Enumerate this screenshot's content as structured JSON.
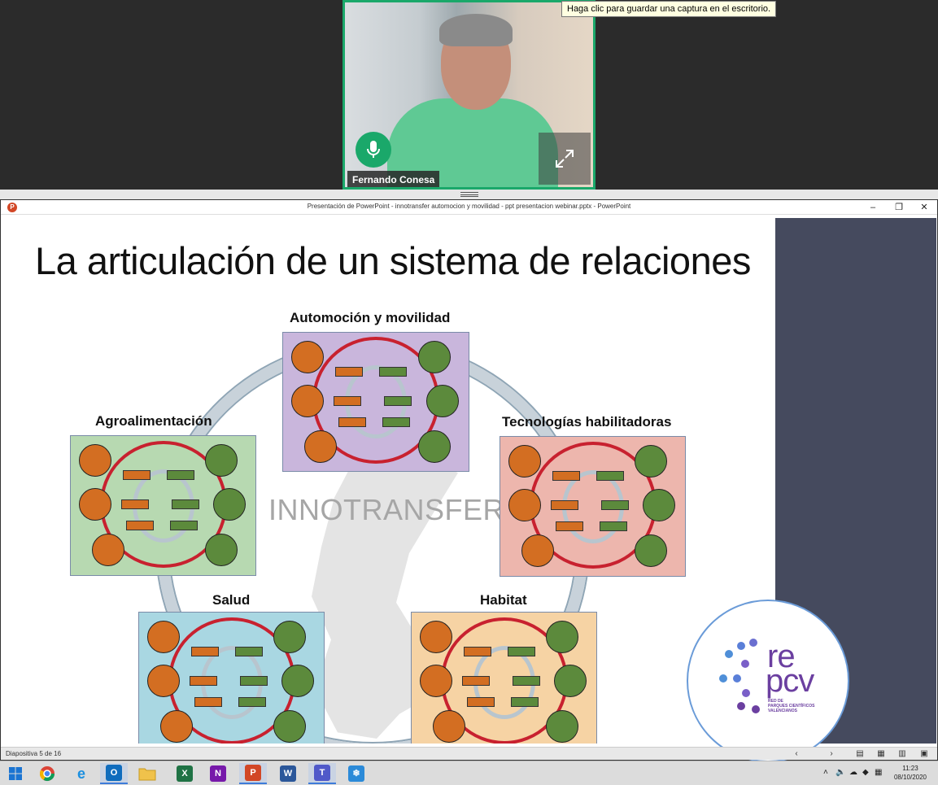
{
  "video": {
    "participant_name": "Fernando Conesa",
    "tooltip": "Haga clic para guardar una captura en el escritorio."
  },
  "ppt": {
    "window_title": "Presentación de PowerPoint  -  innotransfer automocion y movilidad - ppt presentacion webinar.pptx - PowerPoint",
    "status_text": "Diapositiva 5 de 16",
    "slide": {
      "title": "La articulación de un sistema de relaciones",
      "center_label": "INNOTRANSFER",
      "clusters": [
        {
          "label": "Automoción y movilidad",
          "color": "#c9b6dc"
        },
        {
          "label": "Agroalimentación",
          "color": "#b7d9b1"
        },
        {
          "label": "Tecnologías habilitadoras",
          "color": "#edb6ad"
        },
        {
          "label": "Salud",
          "color": "#a9d7e2"
        },
        {
          "label": "Habitat",
          "color": "#f6d3a4"
        }
      ],
      "logo": {
        "line1": "re",
        "line2": "pcv",
        "subtitle_1": "RED DE",
        "subtitle_2": "PARQUES CIENTÍFICOS",
        "subtitle_3": "VALENCIANOS",
        "color": "#6b3fa0"
      }
    }
  },
  "taskbar": {
    "apps": [
      {
        "name": "start",
        "icon": "windows-icon"
      },
      {
        "name": "chrome",
        "icon": "chrome-icon"
      },
      {
        "name": "internet-explorer",
        "icon": "ie-icon"
      },
      {
        "name": "outlook",
        "icon": "outlook-icon",
        "glyph": "O"
      },
      {
        "name": "file-explorer",
        "icon": "folder-icon"
      },
      {
        "name": "excel",
        "icon": "excel-icon",
        "glyph": "X"
      },
      {
        "name": "onenote",
        "icon": "onenote-icon",
        "glyph": "N"
      },
      {
        "name": "powerpoint",
        "icon": "powerpoint-icon",
        "glyph": "P"
      },
      {
        "name": "word",
        "icon": "word-icon",
        "glyph": "W"
      },
      {
        "name": "teams",
        "icon": "teams-icon",
        "glyph": "T"
      },
      {
        "name": "snowflake-app",
        "icon": "snowflake-icon",
        "glyph": "❄"
      }
    ],
    "clock_time": "11:23",
    "clock_date": "08/10/2020"
  }
}
